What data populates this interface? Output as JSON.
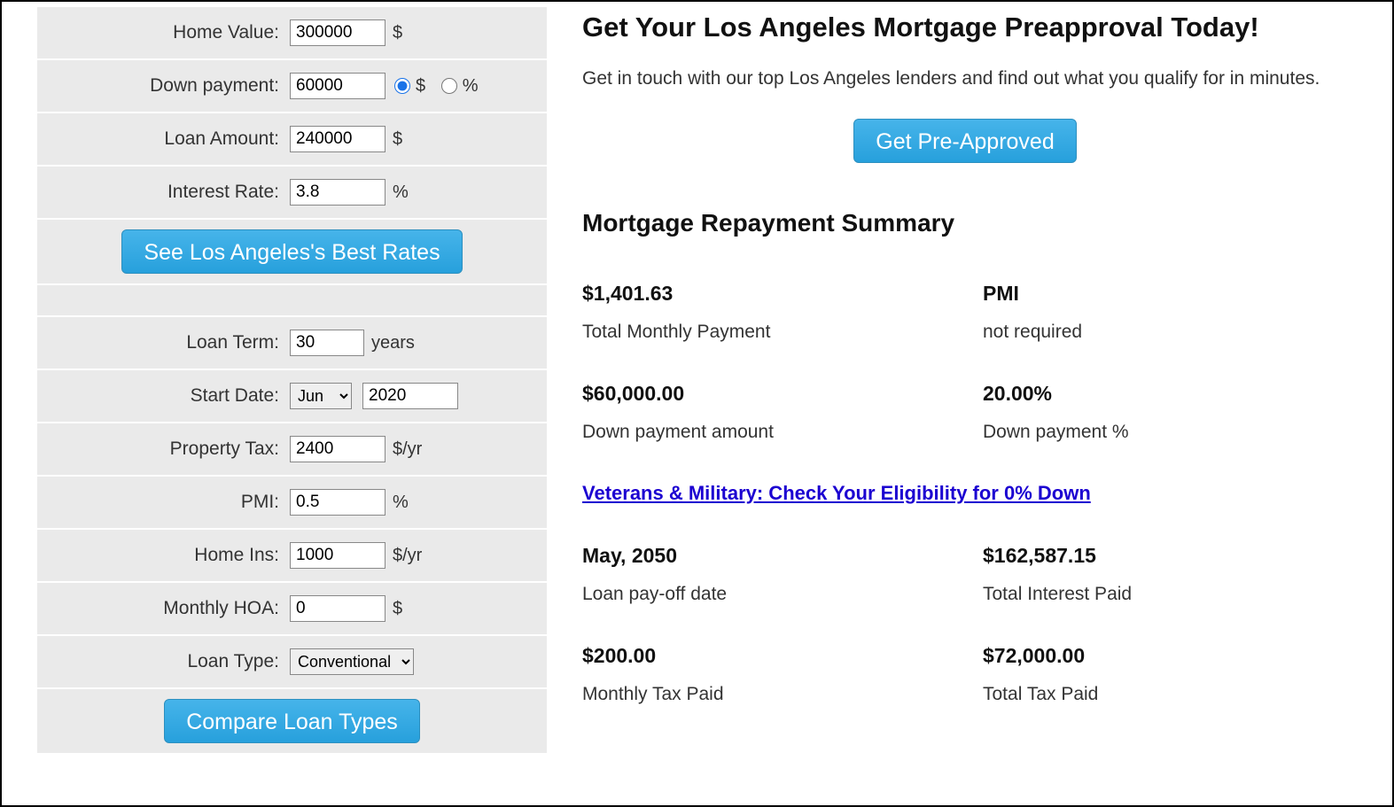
{
  "form": {
    "home_value": {
      "label": "Home Value:",
      "value": "300000",
      "unit": "$"
    },
    "down_payment": {
      "label": "Down payment:",
      "value": "60000",
      "unit_dollar": "$",
      "unit_percent": "%"
    },
    "loan_amount": {
      "label": "Loan Amount:",
      "value": "240000",
      "unit": "$"
    },
    "interest_rate": {
      "label": "Interest Rate:",
      "value": "3.8",
      "unit": "%"
    },
    "best_rates_btn": "See Los Angeles's Best Rates",
    "loan_term": {
      "label": "Loan Term:",
      "value": "30",
      "unit": "years"
    },
    "start_date": {
      "label": "Start Date:",
      "month": "Jun",
      "year": "2020"
    },
    "property_tax": {
      "label": "Property Tax:",
      "value": "2400",
      "unit": "$/yr"
    },
    "pmi": {
      "label": "PMI:",
      "value": "0.5",
      "unit": "%"
    },
    "home_ins": {
      "label": "Home Ins:",
      "value": "1000",
      "unit": "$/yr"
    },
    "hoa": {
      "label": "Monthly HOA:",
      "value": "0",
      "unit": "$"
    },
    "loan_type": {
      "label": "Loan Type:",
      "value": "Conventional"
    },
    "compare_btn": "Compare Loan Types"
  },
  "right": {
    "heading": "Get Your Los Angeles Mortgage Preapproval Today!",
    "subtext": "Get in touch with our top Los Angeles lenders and find out what you qualify for in minutes.",
    "cta_btn": "Get Pre-Approved",
    "summary_heading": "Mortgage Repayment Summary",
    "va_link": "Veterans & Military: Check Your Eligibility for 0% Down",
    "summary": {
      "monthly_payment": {
        "value": "$1,401.63",
        "label": "Total Monthly Payment"
      },
      "pmi_status": {
        "value": "PMI",
        "label": "not required"
      },
      "down_amount": {
        "value": "$60,000.00",
        "label": "Down payment amount"
      },
      "down_pct": {
        "value": "20.00%",
        "label": "Down payment %"
      },
      "payoff": {
        "value": "May, 2050",
        "label": "Loan pay-off date"
      },
      "total_interest": {
        "value": "$162,587.15",
        "label": "Total Interest Paid"
      },
      "monthly_tax": {
        "value": "$200.00",
        "label": "Monthly Tax Paid"
      },
      "total_tax": {
        "value": "$72,000.00",
        "label": "Total Tax Paid"
      }
    }
  }
}
